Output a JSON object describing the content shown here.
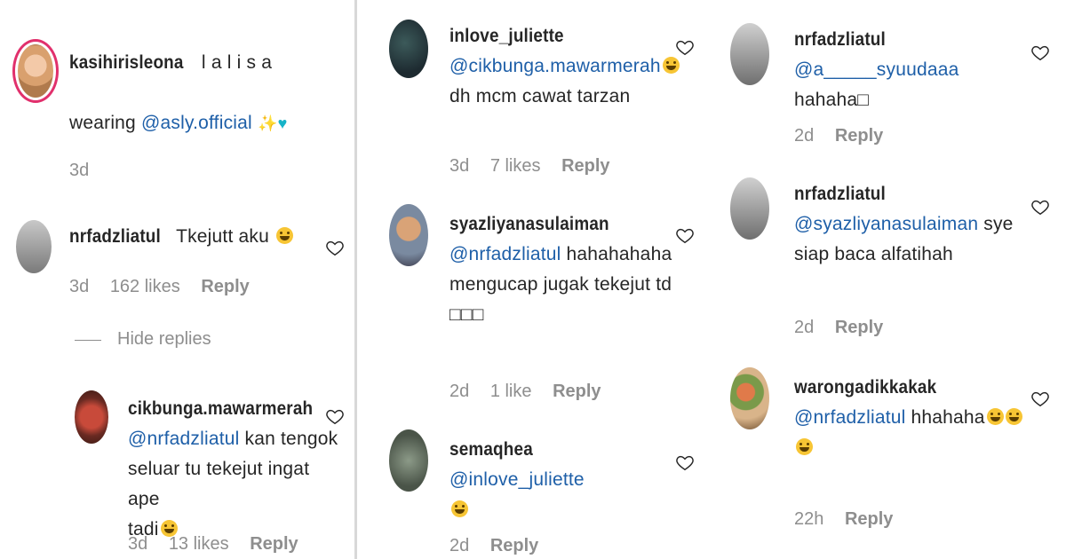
{
  "panel1": {
    "comment1": {
      "username": "kasihirisleona",
      "text1": "l a l i s a",
      "text2": "wearing",
      "mention": "@asly.official",
      "time": "3d"
    },
    "comment2": {
      "username": "nrfadzliatul",
      "text": "Tkejutt aku",
      "time": "3d",
      "likes": "162 likes",
      "reply": "Reply"
    },
    "hide_replies": "Hide replies",
    "comment3": {
      "username": "cikbunga.mawarmerah",
      "mention": "@nrfadzliatul",
      "text": "kan tengok",
      "line2": "seluar tu tekejut ingat ape",
      "line3": "tadi",
      "time": "3d",
      "likes": "13 likes",
      "reply": "Reply"
    }
  },
  "panel2": {
    "comment1": {
      "username": "inlove_juliette",
      "mention": "@cikbunga.mawarmerah",
      "line2": "dh mcm cawat tarzan",
      "time": "3d",
      "likes": "7 likes",
      "reply": "Reply"
    },
    "comment2": {
      "username": "syazliyanasulaiman",
      "mention": "@nrfadzliatul",
      "text": "hahahahaha",
      "line2": "mengucap jugak tekejut td",
      "line3": "□□□",
      "time": "2d",
      "likes": "1 like",
      "reply": "Reply"
    },
    "comment3": {
      "username": "semaqhea",
      "mention": "@inlove_juliette",
      "time": "2d",
      "reply": "Reply"
    }
  },
  "panel3": {
    "comment1": {
      "username": "nrfadzliatul",
      "mention": "@a_____syuudaaa",
      "text": "hahaha□",
      "time": "2d",
      "reply": "Reply"
    },
    "comment2": {
      "username": "nrfadzliatul",
      "mention": "@syazliyanasulaiman",
      "text": "sye",
      "line2": "siap baca alfatihah",
      "time": "2d",
      "reply": "Reply"
    },
    "comment3": {
      "username": "warongadikkakak",
      "mention": "@nrfadzliatul",
      "text": "hhahaha",
      "time": "22h",
      "reply": "Reply"
    }
  },
  "colors": {
    "mention": "#1e5fa8",
    "meta": "#8e8e8e",
    "story_ring": "#e1306c"
  },
  "icons": [
    "heart-icon",
    "grinning-emoji",
    "sparkles-emoji",
    "blue-heart-emoji"
  ]
}
